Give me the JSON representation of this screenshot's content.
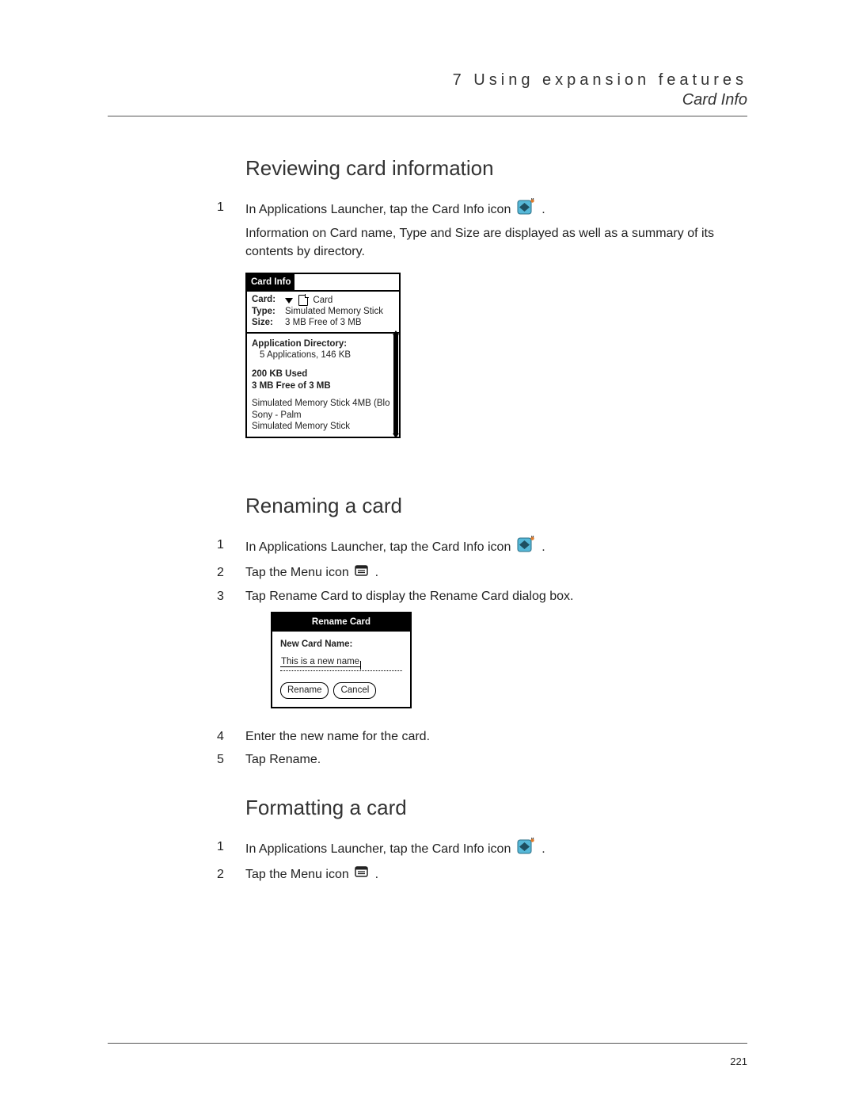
{
  "header": {
    "chapter": "7 Using expansion features",
    "section": "Card Info"
  },
  "page_number": "221",
  "review": {
    "heading": "Reviewing card information",
    "step1_a": "In Applications Launcher, tap the Card Info icon ",
    "step1_b": ".",
    "step1_desc": "Information on Card name, Type and Size are displayed as well as a summary of its contents by directory."
  },
  "card_info_shot": {
    "title": "Card Info",
    "rows": {
      "card_label": "Card:",
      "card_value": "Card",
      "type_label": "Type:",
      "type_value": "Simulated Memory Stick",
      "size_label": "Size:",
      "size_value": "3 MB Free of 3 MB"
    },
    "body": {
      "appdir_label": "Application Directory:",
      "appdir_value": "5 Applications, 146 KB",
      "used": "200 KB Used",
      "free": "3 MB Free of 3 MB",
      "line1": "Simulated Memory Stick 4MB (Blo",
      "line2": "Sony - Palm",
      "line3": "Simulated Memory Stick"
    }
  },
  "rename": {
    "heading": "Renaming a card",
    "step1_a": "In Applications Launcher, tap the Card Info icon ",
    "step1_b": ".",
    "step2_a": "Tap the Menu icon ",
    "step2_b": ".",
    "step3": "Tap Rename Card to display the Rename Card dialog box.",
    "step4": "Enter the new name for the card.",
    "step5": "Tap Rename."
  },
  "rename_shot": {
    "title": "Rename Card",
    "label": "New Card Name:",
    "value": "This is a new name",
    "btn_rename": "Rename",
    "btn_cancel": "Cancel"
  },
  "format": {
    "heading": "Formatting a card",
    "step1_a": "In Applications Launcher, tap the Card Info icon ",
    "step1_b": ".",
    "step2_a": "Tap the Menu icon ",
    "step2_b": "."
  },
  "nums": {
    "n1": "1",
    "n2": "2",
    "n3": "3",
    "n4": "4",
    "n5": "5"
  }
}
